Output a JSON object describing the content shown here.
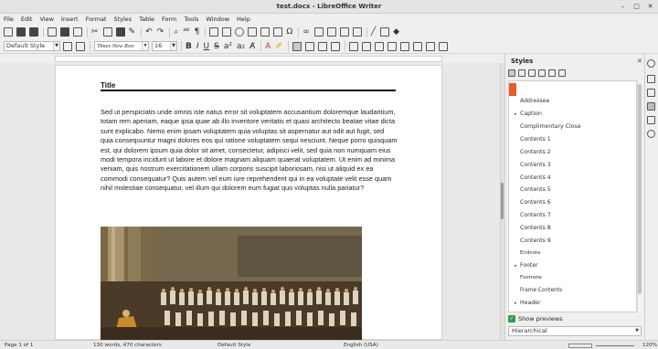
{
  "window": {
    "title": "test.docx - LibreOffice Writer"
  },
  "menu": [
    "File",
    "Edit",
    "View",
    "Insert",
    "Format",
    "Styles",
    "Table",
    "Form",
    "Tools",
    "Window",
    "Help"
  ],
  "toolbar": {
    "paragraph_style": "Default Style",
    "font_name": "Times New Ron",
    "font_size": "16"
  },
  "document": {
    "title": "Title",
    "body": "Sed ut perspiciatis unde omnis iste natus error sit voluptatem accusantium doloremque laudantium, totam rem aperiam, eaque ipsa quae ab illo inventore veritatis et quasi architecto beatae vitae dicta sunt explicabo. Nemo enim ipsam voluptatem quia voluptas sit aspernatur aut odit aut fugit, sed quia consequuntur magni dolores eos qui ratione voluptatem sequi nesciunt. Neque porro quisquam est, qui dolorem ipsum quia dolor sit amet, consectetur, adipisci velit, sed quia non numquam eius modi tempora incidunt ut labore et dolore magnam aliquam quaerat voluptatem. Ut enim ad minima veniam, quis nostrum exercitationem ullam corporis suscipit laboriosam, nisi ut aliquid ex ea commodi consequatur? Quis autem vel eum iure reprehenderit qui in ea voluptate velit esse quam nihil molestiae consequatur, vel illum qui dolorem eum fugiat quo voluptas nulla pariatur?"
  },
  "styles_panel": {
    "title": "Styles",
    "items": [
      "Addressee",
      "Caption",
      "Complimentary Close",
      "Contents 1",
      "Contents 2",
      "Contents 3",
      "Contents 4",
      "Contents 5",
      "Contents 6",
      "Contents 7",
      "Contents 8",
      "Contents 9",
      "Endnote",
      "Footer",
      "Footnote",
      "Frame Contents",
      "Header"
    ],
    "show_previews": "Show previews",
    "filter": "Hierarchical"
  },
  "status": {
    "page": "Page 1 of 1",
    "words": "130 words, 470 characters",
    "style": "Default Style",
    "language": "English (USA)",
    "zoom": "120%"
  },
  "colors": {
    "accent": "#e85b2a",
    "checkbox": "#2f9b48"
  }
}
